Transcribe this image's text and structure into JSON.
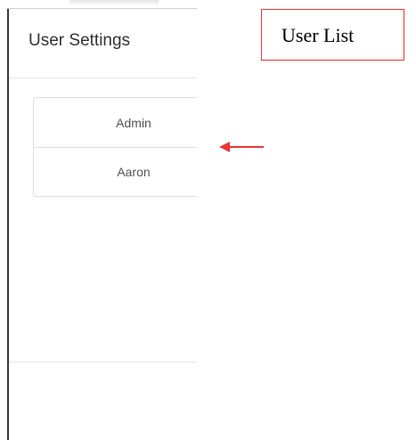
{
  "dialog": {
    "title": "User Settings",
    "users": [
      {
        "name": "Admin"
      },
      {
        "name": "Aaron"
      }
    ]
  },
  "annotation": {
    "label": "User List",
    "color": "#e53935"
  },
  "icons": {
    "annotation_arrow": "left-arrow-icon"
  }
}
